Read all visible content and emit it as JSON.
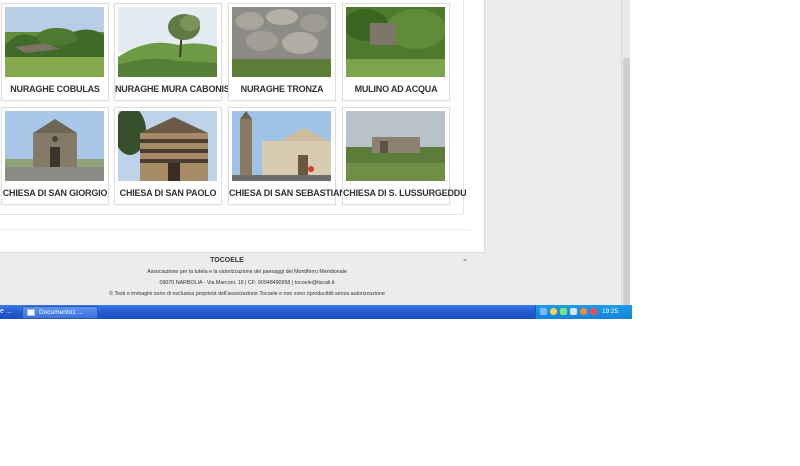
{
  "gallery": {
    "items": [
      {
        "label": "NURAGHE COBULAS",
        "image": "stone-ruin-photo"
      },
      {
        "label": "NURAGHE MURA CABONIS",
        "image": "tree-hill-photo"
      },
      {
        "label": "NURAGHE TRONZA",
        "image": "stone-wall-photo"
      },
      {
        "label": "MULINO AD ACQUA",
        "image": "overgrown-mill-photo"
      },
      {
        "label": "CHIESA DI SAN GIORGIO",
        "image": "stone-church-photo"
      },
      {
        "label": "CHIESA DI SAN PAOLO",
        "image": "striped-church-photo"
      },
      {
        "label": "CHIESA DI SAN SEBASTIANO",
        "image": "bell-tower-church-photo"
      },
      {
        "label": "CHIESA DI S. LUSSURGEDDU",
        "image": "ruined-chapel-photo"
      }
    ]
  },
  "footer": {
    "title": "TOCOELE",
    "line1": "Associazione per la tutela e la valorizzazione dei paesaggi del Montiferru Meridionale",
    "line2": "09070 NARBOLIA - Via Marconi, 19 | CF: 90048490958 | tocoele@tiscali.it",
    "line3": "© Testi e immagini sono di esclusiva proprietà dell'associazione Tocoele e non sono riproducibili senza autorizzazione"
  },
  "taskbar": {
    "left_label": "e ...",
    "document_label": "Documento1 ...",
    "clock": "19:25"
  }
}
